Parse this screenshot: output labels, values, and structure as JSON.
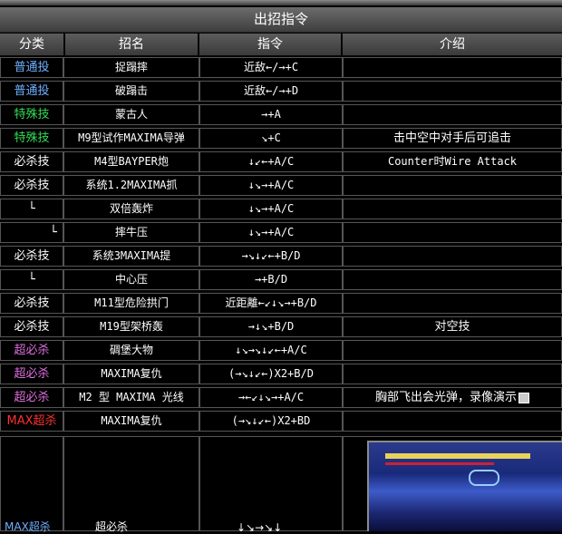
{
  "title": "出招指令",
  "headers": [
    "分类",
    "招名",
    "指令",
    "介绍"
  ],
  "rows": [
    {
      "cat": "普通投",
      "cat_color": "#6fb0ff",
      "name": "捉蹋摔",
      "cmd": "近敌←/→+C",
      "desc": ""
    },
    {
      "cat": "普通投",
      "cat_color": "#6fb0ff",
      "name": "破蹋击",
      "cmd": "近敌←/→+D",
      "desc": ""
    },
    {
      "cat": "特殊技",
      "cat_color": "#33dd55",
      "name": "蒙古人",
      "cmd": "→+A",
      "desc": ""
    },
    {
      "cat": "特殊技",
      "cat_color": "#33dd55",
      "name": "M9型试作MAXIMA导弹",
      "cmd": "↘+C",
      "desc": "击中空中对手后可追击"
    },
    {
      "cat": "必杀技",
      "cat_color": "#ffffff",
      "name": "M4型BAYPER炮",
      "cmd": "↓↙←+A/C",
      "desc": "Counter时Wire Attack"
    },
    {
      "cat": "必杀技",
      "cat_color": "#ffffff",
      "name": "系统1.2MAXIMA抓",
      "cmd": "↓↘→+A/C",
      "desc": ""
    },
    {
      "cat": "└",
      "cat_color": "#ffffff",
      "name": "双倍轰炸",
      "cmd": "↓↘→+A/C",
      "desc": ""
    },
    {
      "cat": "└",
      "cat_color": "#ffffff",
      "name": "摔牛压",
      "cmd": "↓↘→+A/C",
      "desc": ""
    },
    {
      "cat": "必杀技",
      "cat_color": "#ffffff",
      "name": "系统3MAXIMA提",
      "cmd": "→↘↓↙←+B/D",
      "desc": ""
    },
    {
      "cat": "└",
      "cat_color": "#ffffff",
      "name": "中心压",
      "cmd": "→+B/D",
      "desc": ""
    },
    {
      "cat": "必杀技",
      "cat_color": "#ffffff",
      "name": "M11型危险拱门",
      "cmd": "近距離←↙↓↘→+B/D",
      "desc": ""
    },
    {
      "cat": "必杀技",
      "cat_color": "#ffffff",
      "name": "M19型架桥轰",
      "cmd": "→↓↘+B/D",
      "desc": "对空技"
    },
    {
      "cat": "超必杀",
      "cat_color": "#e070e0",
      "name": "碉堡大物",
      "cmd": "↓↘→↘↓↙←+A/C",
      "desc": ""
    },
    {
      "cat": "超必杀",
      "cat_color": "#e070e0",
      "name": "MAXIMA复仇",
      "cmd": "(→↘↓↙←)X2+B/D",
      "desc": ""
    },
    {
      "cat": "超必杀",
      "cat_color": "#e070e0",
      "name": "M2 型 MAXIMA 光线",
      "cmd": "→←↙↓↘→+A/C",
      "desc": "胸部飞出会光弹，录像演示"
    },
    {
      "cat": "MAX超杀",
      "cat_color": "#ff3030",
      "name": "MAXIMA复仇",
      "cmd": "(→↘↓↙←)X2+BD",
      "desc": ""
    }
  ],
  "partial_row": {
    "cat": "MAX超杀",
    "name": "超必杀",
    "cmd": "↓↘→↘↓"
  },
  "colors": {
    "cell_bg": "#000000",
    "border": "#555555",
    "header_bg": "#4a4a4a"
  }
}
